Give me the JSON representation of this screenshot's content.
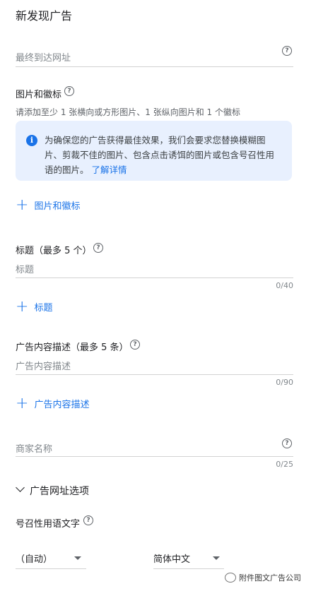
{
  "page": {
    "title": "新发现广告"
  },
  "final_url": {
    "placeholder": "最终到达网址"
  },
  "images": {
    "label": "图片和徽标",
    "hint": "请添加至少 1 张横向或方形图片、1 张纵向图片和 1 个徽标",
    "info_text": "为确保您的广告获得最佳效果，我们会要求您替换模糊图片、剪裁不佳的图片、包含点击诱饵的图片或包含号召性用语的图片。",
    "info_link": "了解详情",
    "add_label": "图片和徽标"
  },
  "headline": {
    "label": "标题（最多 5 个）",
    "placeholder": "标题",
    "counter": "0/40",
    "add_label": "标题"
  },
  "description": {
    "label": "广告内容描述（最多 5 条）",
    "placeholder": "广告内容描述",
    "counter": "0/90",
    "add_label": "广告内容描述"
  },
  "business_name": {
    "placeholder": "商家名称",
    "counter": "0/25"
  },
  "url_options": {
    "label": "广告网址选项"
  },
  "cta": {
    "label": "号召性用语文字",
    "select_value": "（自动）",
    "language_value": "简体中文"
  },
  "watermark": {
    "text": "附件图文广告公司"
  },
  "colors": {
    "accent": "#1a73e8",
    "info_bg": "#e8f0fe",
    "divider": "#d2d2d2"
  }
}
